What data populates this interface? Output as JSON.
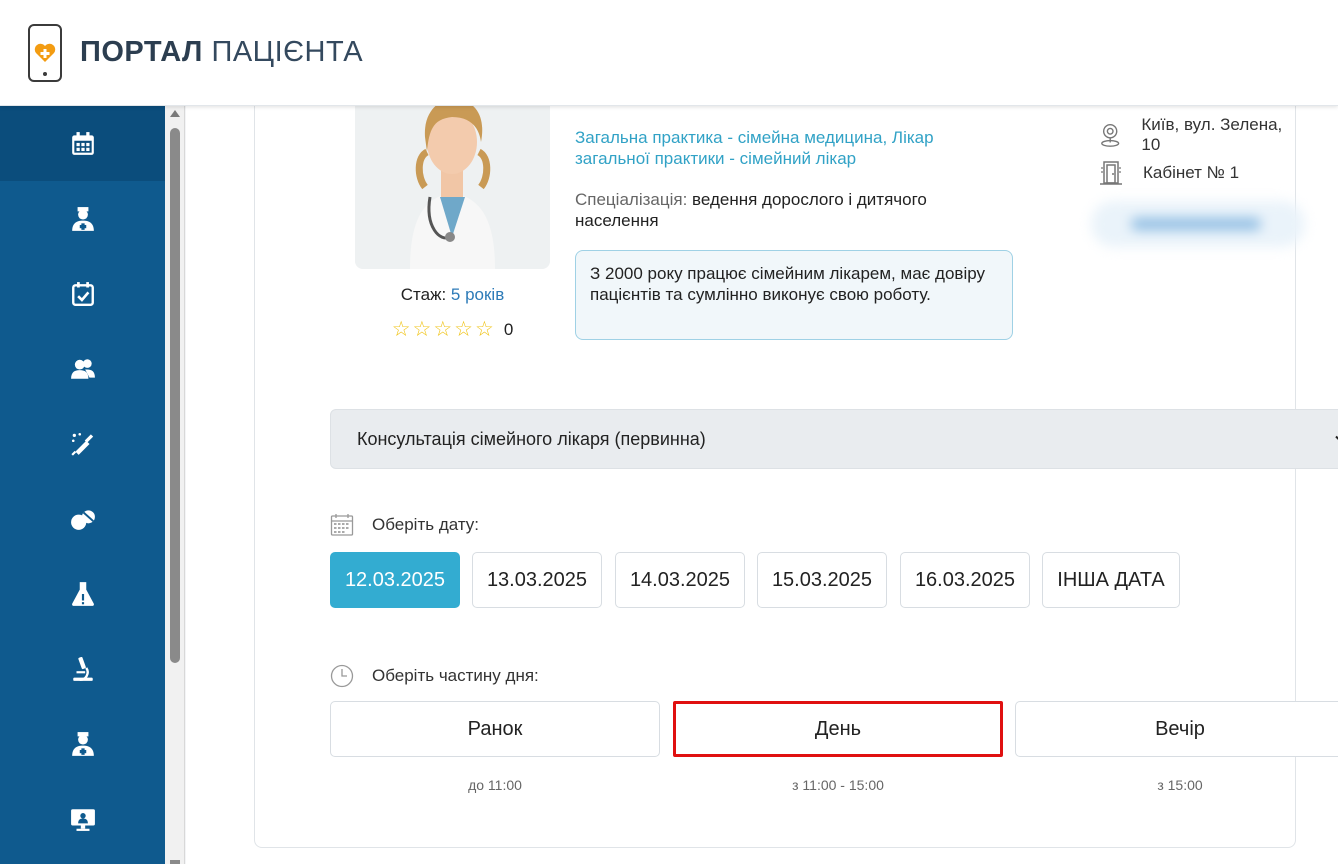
{
  "header": {
    "title_bold": "ПОРТАЛ",
    "title_thin": "ПАЦІЄНТА"
  },
  "sidebar": {
    "items": [
      {
        "icon": "calendar-icon",
        "active": true
      },
      {
        "icon": "doctor-icon",
        "active": false
      },
      {
        "icon": "calendar-check-icon",
        "active": false
      },
      {
        "icon": "users-icon",
        "active": false
      },
      {
        "icon": "syringe-icon",
        "active": false
      },
      {
        "icon": "pills-icon",
        "active": false
      },
      {
        "icon": "flask-icon",
        "active": false
      },
      {
        "icon": "microscope-icon",
        "active": false
      },
      {
        "icon": "doctor-icon",
        "active": false
      },
      {
        "icon": "monitor-icon",
        "active": false
      }
    ]
  },
  "doctor": {
    "specialty": "Загальна практика - сімейна медицина, Лікар загальної практики - сімейний лікар",
    "specialization_label": "Спеціалізація:",
    "specialization_value": "ведення дорослого і дитячого населення",
    "bio": "З 2000 року працює сімейним лікарем, має довіру пацієнтів та сумлінно виконує свою роботу.",
    "experience_label": "Стаж:",
    "experience_value": "5 років",
    "rating": 0,
    "rating_count": "0",
    "address": "Київ, вул. Зелена, 10",
    "cabinet": "Кабінет № 1"
  },
  "service_select": {
    "selected": "Консультація сімейного лікаря (первинна)"
  },
  "date_section": {
    "label": "Оберіть дату:",
    "dates": [
      "12.03.2025",
      "13.03.2025",
      "14.03.2025",
      "15.03.2025",
      "16.03.2025"
    ],
    "other": "ІНША ДАТА",
    "selected": "12.03.2025"
  },
  "daypart_section": {
    "label": "Оберіть частину дня:",
    "parts": [
      {
        "label": "Ранок",
        "sub": "до 11:00"
      },
      {
        "label": "День",
        "sub": "з 11:00 - 15:00"
      },
      {
        "label": "Вечір",
        "sub": "з 15:00"
      }
    ]
  },
  "colors": {
    "sidebar": "#0f5a8e",
    "accent": "#33acd1",
    "highlight": "#e01010"
  }
}
